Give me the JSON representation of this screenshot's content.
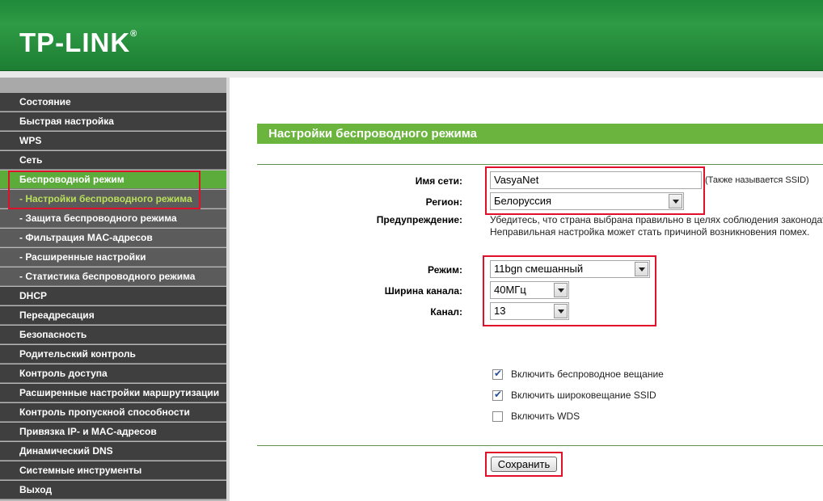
{
  "brand": {
    "logo": "TP-LINK",
    "mark": "®"
  },
  "sidebar": {
    "items": [
      {
        "label": "Состояние"
      },
      {
        "label": "Быстрая настройка"
      },
      {
        "label": "WPS"
      },
      {
        "label": "Сеть"
      },
      {
        "label": "Беспроводной режим"
      },
      {
        "label": "- Настройки беспроводного режима"
      },
      {
        "label": "- Защита беспроводного режима"
      },
      {
        "label": "- Фильтрация MAC-адресов"
      },
      {
        "label": "- Расширенные настройки"
      },
      {
        "label": "- Статистика беспроводного режима"
      },
      {
        "label": "DHCP"
      },
      {
        "label": "Переадресация"
      },
      {
        "label": "Безопасность"
      },
      {
        "label": "Родительский контроль"
      },
      {
        "label": "Контроль доступа"
      },
      {
        "label": "Расширенные настройки маршрутизации"
      },
      {
        "label": "Контроль пропускной способности"
      },
      {
        "label": "Привязка IP- и MAC-адресов"
      },
      {
        "label": "Динамический DNS"
      },
      {
        "label": "Системные инструменты"
      },
      {
        "label": "Выход"
      }
    ]
  },
  "main": {
    "title": "Настройки беспроводного режима",
    "ssid": {
      "label": "Имя сети:",
      "value": "VasyaNet",
      "hint": "(Также называется SSID)"
    },
    "region": {
      "label": "Регион:",
      "value": "Белоруссия"
    },
    "warning": {
      "label": "Предупреждение:",
      "line1": "Убедитесь, что страна выбрана правильно в целях соблюдения законодат",
      "line2": "Неправильная настройка может стать причиной возникновения помех."
    },
    "mode": {
      "label": "Режим:",
      "value": "11bgn смешанный"
    },
    "width": {
      "label": "Ширина канала:",
      "value": "40МГц"
    },
    "channel": {
      "label": "Канал:",
      "value": "13"
    },
    "options": [
      {
        "label": "Включить беспроводное вещание",
        "checked": true
      },
      {
        "label": "Включить широковещание SSID",
        "checked": true
      },
      {
        "label": "Включить WDS",
        "checked": false
      }
    ],
    "save_label": "Сохранить"
  },
  "colors": {
    "brand_green": "#2e9b45",
    "title_green": "#6bb43d",
    "highlight_red": "#e0102a",
    "menu_dark": "#3f3f3f"
  }
}
